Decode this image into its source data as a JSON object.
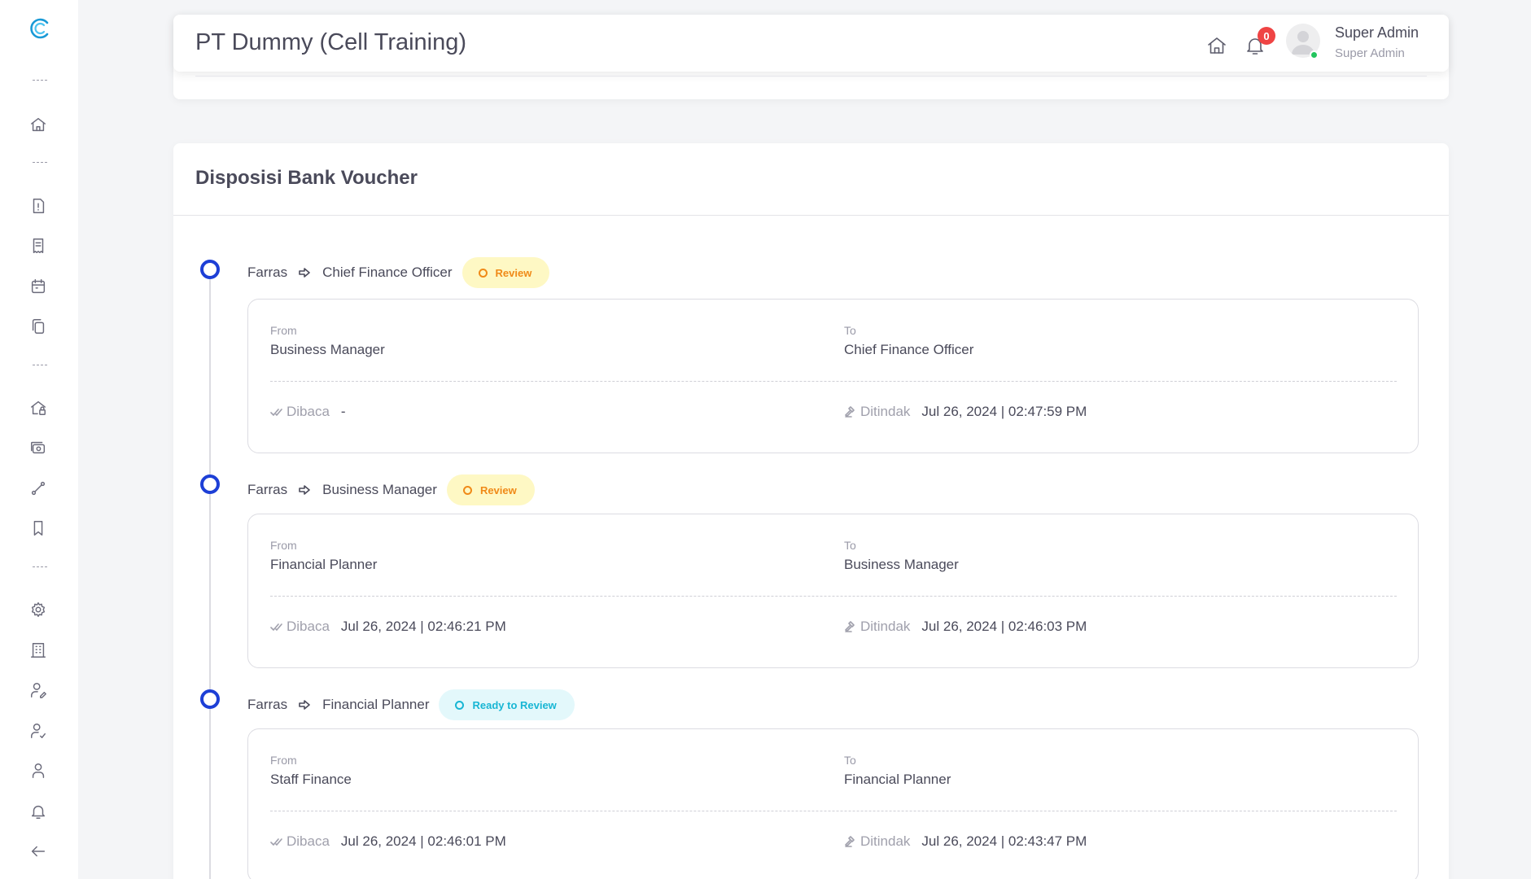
{
  "header": {
    "title": "PT Dummy (Cell Training)",
    "notification_count": "0",
    "user_name": "Super Admin",
    "user_role": "Super Admin"
  },
  "sidebar": {
    "items": [
      {
        "icon": "home-icon"
      },
      {
        "icon": "report-icon"
      },
      {
        "icon": "receipt-icon"
      },
      {
        "icon": "calendar-icon"
      },
      {
        "icon": "copy-icon"
      },
      {
        "icon": "house-lock-icon"
      },
      {
        "icon": "cash-icon"
      },
      {
        "icon": "route-icon"
      },
      {
        "icon": "bookmark-icon"
      },
      {
        "icon": "settings-icon"
      },
      {
        "icon": "building-icon"
      },
      {
        "icon": "user-edit-icon"
      },
      {
        "icon": "user-check-icon"
      },
      {
        "icon": "user-icon"
      },
      {
        "icon": "bell-icon"
      },
      {
        "icon": "arrow-left-icon"
      }
    ]
  },
  "main": {
    "title": "Disposisi Bank Voucher",
    "labels": {
      "from": "From",
      "to": "To",
      "dibaca": "Dibaca",
      "ditindak": "Ditindak"
    },
    "entries": [
      {
        "actor": "Farras",
        "target": "Chief Finance Officer",
        "status": "Review",
        "from": "Business Manager",
        "to": "Chief Finance Officer",
        "dibaca": "-",
        "ditindak": "Jul 26, 2024 | 02:47:59 PM"
      },
      {
        "actor": "Farras",
        "target": "Business Manager",
        "status": "Review",
        "from": "Financial Planner",
        "to": "Business Manager",
        "dibaca": "Jul 26, 2024 | 02:46:21 PM",
        "ditindak": "Jul 26, 2024 | 02:46:03 PM"
      },
      {
        "actor": "Farras",
        "target": "Financial Planner",
        "status": "Ready to Review",
        "from": "Staff Finance",
        "to": "Financial Planner",
        "dibaca": "Jul 26, 2024 | 02:46:01 PM",
        "ditindak": "Jul 26, 2024 | 02:43:47 PM"
      }
    ]
  },
  "colors": {
    "accent": "#1d3fd6",
    "review_bg": "#fef8c4",
    "review_text": "#f08a18",
    "ready_bg": "#e3f8fb",
    "ready_text": "#18b6d4",
    "badge_red": "#ef4444",
    "online": "#22c55e"
  }
}
